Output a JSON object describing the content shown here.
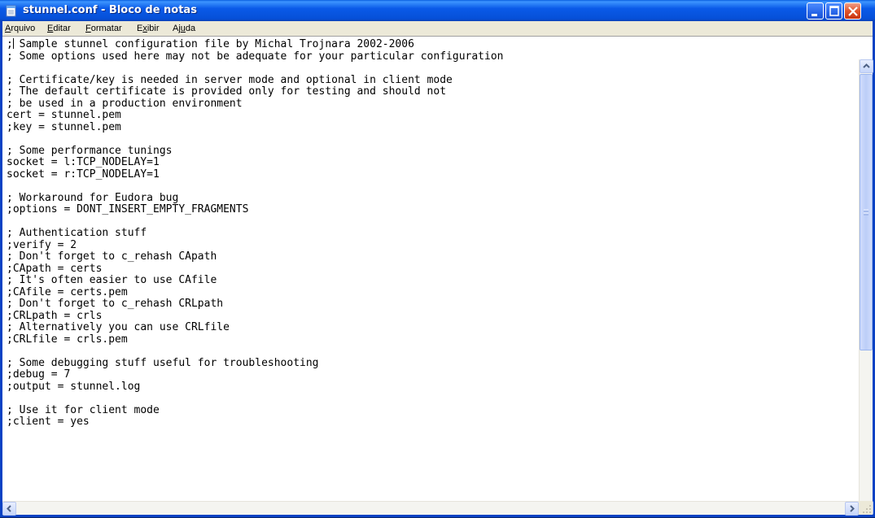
{
  "window": {
    "title": "stunnel.conf - Bloco de notas",
    "icon": "notepad-icon",
    "buttons": [
      "minimize-icon",
      "maximize-icon",
      "close-icon"
    ]
  },
  "menu": {
    "items": [
      {
        "accel": "A",
        "rest": "rquivo"
      },
      {
        "accel": "E",
        "rest": "ditar"
      },
      {
        "accel": "F",
        "rest": "ormatar"
      },
      {
        "pre": "E",
        "accel": "x",
        "rest": "ibir"
      },
      {
        "pre": "Aj",
        "accel": "u",
        "rest": "da"
      }
    ]
  },
  "document": {
    "first_line_rest": " Sample stunnel configuration file by Michal Trojnara 2002-2006",
    "body": "; Some options used here may not be adequate for your particular configuration\n\n; Certificate/key is needed in server mode and optional in client mode\n; The default certificate is provided only for testing and should not\n; be used in a production environment\ncert = stunnel.pem\n;key = stunnel.pem\n\n; Some performance tunings\nsocket = l:TCP_NODELAY=1\nsocket = r:TCP_NODELAY=1\n\n; Workaround for Eudora bug\n;options = DONT_INSERT_EMPTY_FRAGMENTS\n\n; Authentication stuff\n;verify = 2\n; Don't forget to c_rehash CApath\n;CApath = certs\n; It's often easier to use CAfile\n;CAfile = certs.pem\n; Don't forget to c_rehash CRLpath\n;CRLpath = crls\n; Alternatively you can use CRLfile\n;CRLfile = crls.pem\n\n; Some debugging stuff useful for troubleshooting\n;debug = 7\n;output = stunnel.log\n\n; Use it for client mode\n;client = yes"
  },
  "colors": {
    "titlebar": "#0a5ae8",
    "frame": "#0842c4",
    "menubar": "#ece9d8",
    "close": "#e0542a"
  }
}
